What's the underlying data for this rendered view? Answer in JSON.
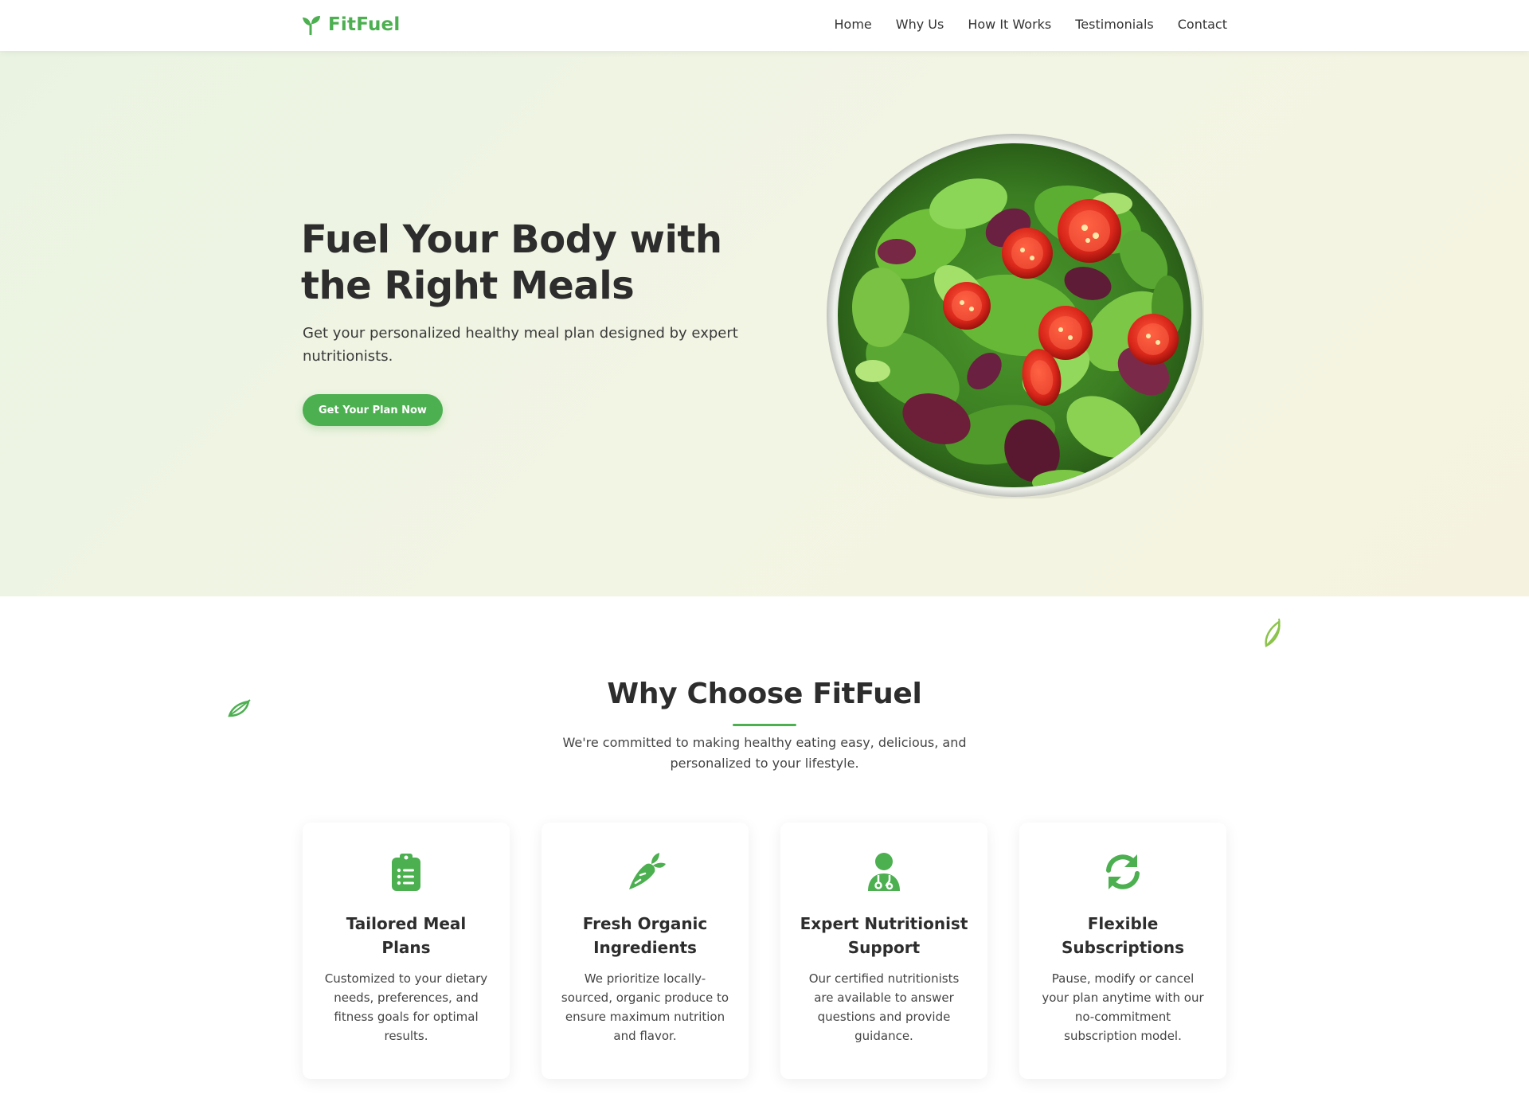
{
  "nav": {
    "brand": "FitFuel",
    "brand_icon": "sprout-icon",
    "links": [
      "Home",
      "Why Us",
      "How It Works",
      "Testimonials",
      "Contact"
    ]
  },
  "hero": {
    "title": "Fuel Your Body with the Right Meals",
    "subtitle": "Get your personalized healthy meal plan designed by expert nutritionists.",
    "cta_label": "Get Your Plan Now"
  },
  "why": {
    "title": "Why Choose FitFuel",
    "subtitle": "We're committed to making healthy eating easy, delicious, and personalized to your lifestyle.",
    "cards": [
      {
        "icon": "clipboard-list-icon",
        "title": "Tailored Meal Plans",
        "text": "Customized to your dietary needs, preferences, and fitness goals for optimal results."
      },
      {
        "icon": "carrot-icon",
        "title": "Fresh Organic Ingredients",
        "text": "We prioritize locally-sourced, organic produce to ensure maximum nutrition and flavor."
      },
      {
        "icon": "doctor-icon",
        "title": "Expert Nutritionist Support",
        "text": "Our certified nutritionists are available to answer questions and provide guidance."
      },
      {
        "icon": "refresh-icon",
        "title": "Flexible Subscriptions",
        "text": "Pause, modify or cancel your plan anytime with our no-commitment subscription model."
      }
    ]
  },
  "colors": {
    "accent": "#4caf50",
    "text": "#2d2d2d",
    "hero_bg": "#f1f5e3"
  }
}
